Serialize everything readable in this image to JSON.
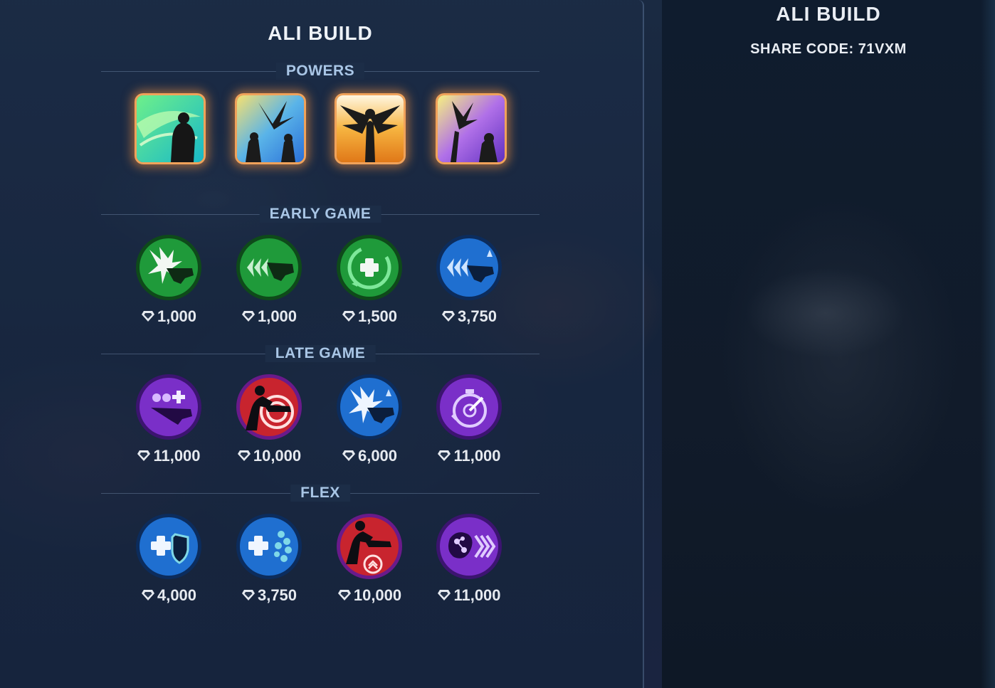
{
  "panel": {
    "title": "ALI BUILD",
    "sections": {
      "powers": "POWERS",
      "early": "EARLY GAME",
      "late": "LATE GAME",
      "flex": "FLEX"
    }
  },
  "sidebar": {
    "title": "ALI BUILD",
    "share_code": "SHARE CODE: 71VXM"
  },
  "powers": [
    {
      "icon": "swirl-strike-power-icon",
      "color": "#2ecf7a"
    },
    {
      "icon": "winged-dive-power-icon",
      "color": "#5ab4e8"
    },
    {
      "icon": "angel-wings-power-icon",
      "color": "#f0a030"
    },
    {
      "icon": "staff-strike-power-icon",
      "color": "#a060e0"
    }
  ],
  "early_game": [
    {
      "icon": "burst-blaster-icon",
      "cost": "1,000",
      "color": "#1f9a3a"
    },
    {
      "icon": "rapid-fire-blaster-icon",
      "cost": "1,000",
      "color": "#1f9a3a"
    },
    {
      "icon": "heal-cycle-icon",
      "cost": "1,500",
      "color": "#1f9a3a"
    },
    {
      "icon": "rapid-fire-ammo-icon",
      "cost": "3,750",
      "color": "#1f6fd0"
    }
  ],
  "late_game": [
    {
      "icon": "team-heal-blaster-icon",
      "cost": "11,000",
      "color": "#7a2fc8"
    },
    {
      "icon": "runner-target-icon",
      "cost": "10,000",
      "color": "#c8242e"
    },
    {
      "icon": "burst-ammo-icon",
      "cost": "6,000",
      "color": "#1f6fd0"
    },
    {
      "icon": "stopwatch-target-icon",
      "cost": "11,000",
      "color": "#7a2fc8"
    }
  ],
  "flex": [
    {
      "icon": "heal-shield-icon",
      "cost": "4,000",
      "color": "#1f6fd0"
    },
    {
      "icon": "heal-orb-icon",
      "cost": "3,750",
      "color": "#1f6fd0"
    },
    {
      "icon": "runner-boost-icon",
      "cost": "10,000",
      "color": "#c8242e"
    },
    {
      "icon": "molecule-speed-icon",
      "cost": "11,000",
      "color": "#7a2fc8"
    }
  ]
}
